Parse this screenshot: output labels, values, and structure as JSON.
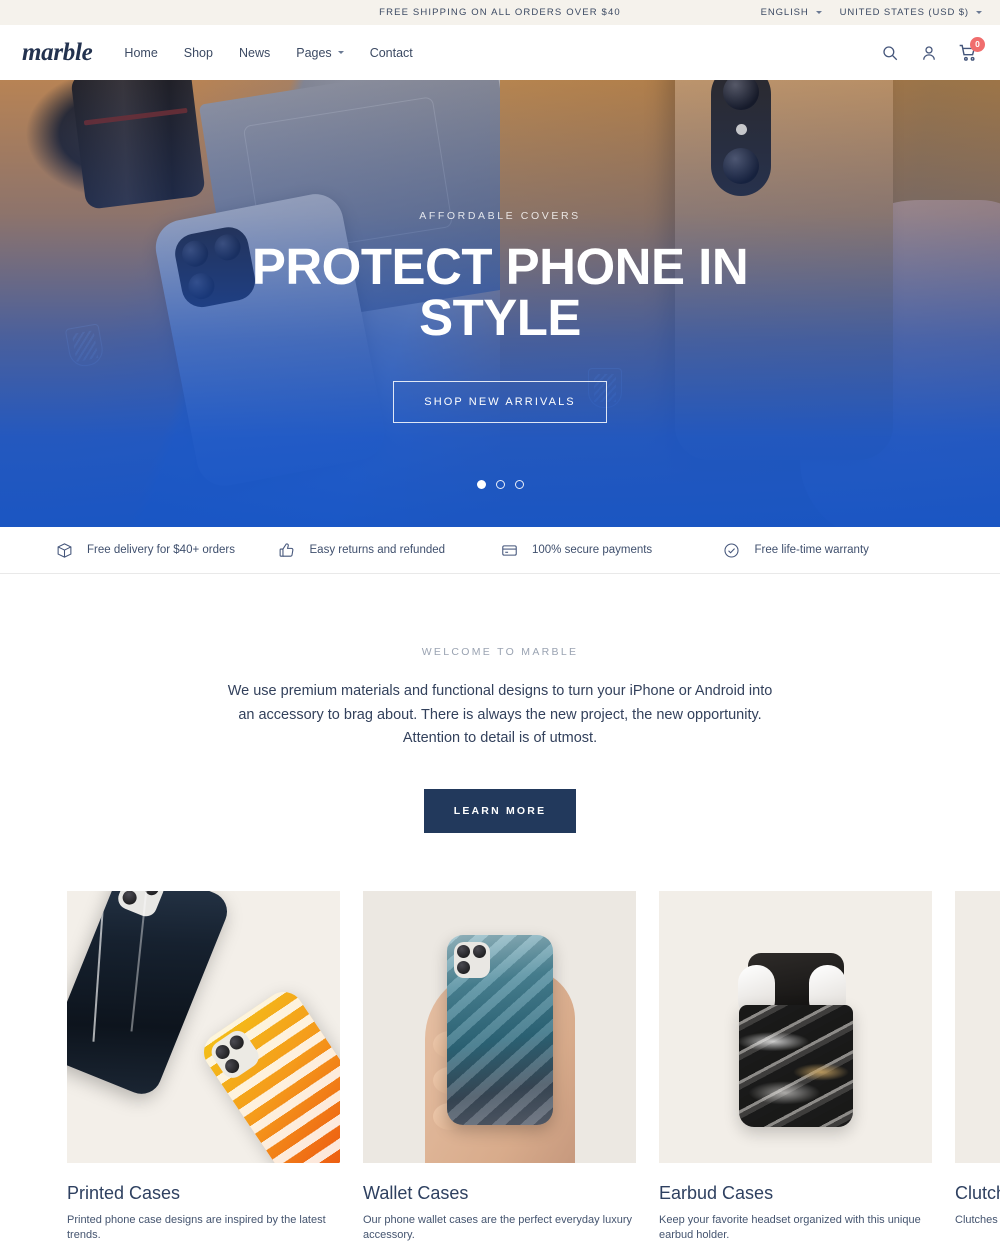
{
  "announcement": {
    "message": "FREE SHIPPING ON ALL ORDERS OVER $40",
    "language": "ENGLISH",
    "currency": "UNITED STATES (USD $)"
  },
  "header": {
    "logo": "marble",
    "nav": [
      {
        "label": "Home",
        "has_dropdown": false
      },
      {
        "label": "Shop",
        "has_dropdown": false
      },
      {
        "label": "News",
        "has_dropdown": false
      },
      {
        "label": "Pages",
        "has_dropdown": true
      },
      {
        "label": "Contact",
        "has_dropdown": false
      }
    ],
    "icons": {
      "search": "search-icon",
      "account": "user-icon",
      "cart": "cart-icon"
    },
    "cart_count": "0",
    "cart_badge_color": "#f06d6d"
  },
  "hero": {
    "eyebrow": "AFFORDABLE COVERS",
    "title": "PROTECT PHONE IN STYLE",
    "button": "SHOP NEW ARRIVALS",
    "slides": 3,
    "active_slide": 1,
    "overlay_color": "#1554c6"
  },
  "features": [
    {
      "icon": "package-icon",
      "text": "Free delivery for $40+ orders"
    },
    {
      "icon": "thumbs-up-icon",
      "text": "Easy returns and refunded"
    },
    {
      "icon": "credit-card-icon",
      "text": "100% secure payments"
    },
    {
      "icon": "check-circle-icon",
      "text": "Free life-time warranty"
    }
  ],
  "welcome": {
    "eyebrow": "WELCOME TO MARBLE",
    "body": "We use premium materials and functional designs to turn your iPhone or Android into an accessory to brag about. There is always the new project, the new opportunity. Attention to detail is of utmost.",
    "button": "LEARN MORE",
    "button_color": "#22395c"
  },
  "collections": [
    {
      "title": "Printed Cases",
      "description": "Printed phone case designs are inspired by the latest trends."
    },
    {
      "title": "Wallet Cases",
      "description": "Our phone wallet cases are the perfect everyday luxury accessory."
    },
    {
      "title": "Earbud Cases",
      "description": "Keep your favorite headset organized with this unique earbud holder."
    },
    {
      "title": "Clutch",
      "description": "Clutches ar"
    }
  ]
}
